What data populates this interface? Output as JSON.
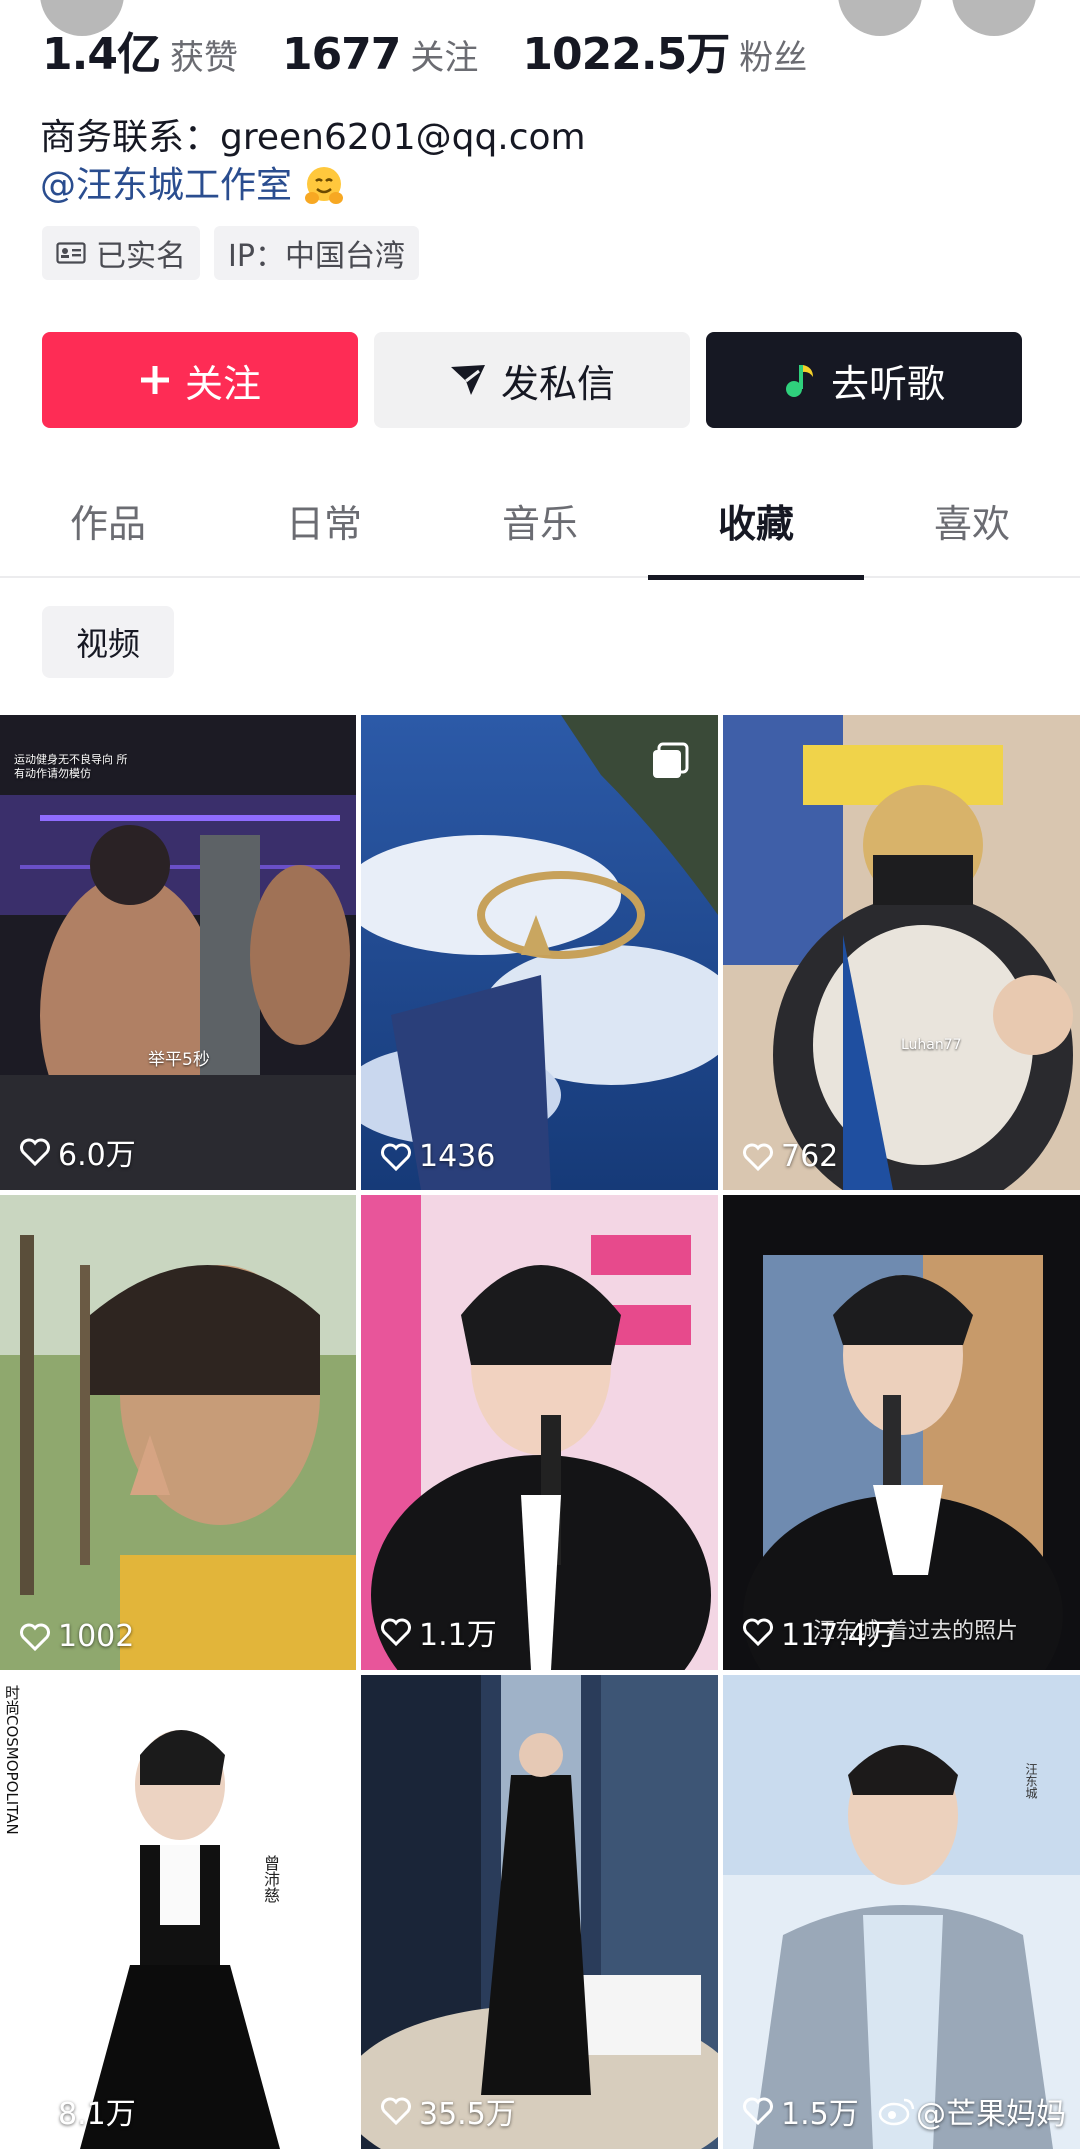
{
  "stats": [
    {
      "num": "1.4亿",
      "label": "获赞"
    },
    {
      "num": "1677",
      "label": "关注"
    },
    {
      "num": "1022.5万",
      "label": "粉丝"
    }
  ],
  "bio": {
    "contact": "商务联系：green6201@qq.com",
    "mention": "@汪东城工作室"
  },
  "tags": [
    "已实名",
    "IP：中国台湾"
  ],
  "actions": {
    "follow": "关注",
    "message": "发私信",
    "music": "去听歌"
  },
  "tabs": [
    "作品",
    "日常",
    "音乐",
    "收藏",
    "喜欢"
  ],
  "active_tab": "收藏",
  "filter": "视频",
  "videos": [
    {
      "likes": "6.0万",
      "overlay": "举平5秒",
      "overlay_small": "运动健身无不良导向 所有动作请勿模仿"
    },
    {
      "likes": "1436"
    },
    {
      "likes": "762",
      "overlay": "Luhan77"
    },
    {
      "likes": "1002"
    },
    {
      "likes": "1.1万"
    },
    {
      "likes": "117.4万",
      "overlay": "汪东城 着过去的照片"
    },
    {
      "likes": "8.1万",
      "overlay": "曾沛慈",
      "overlay_side": "时尚COSMOPOLITAN"
    },
    {
      "likes": "35.5万"
    },
    {
      "likes": "1.5万",
      "overlay": "汪东城"
    }
  ],
  "watermark": "@芒果妈妈",
  "colors": {
    "accent": "#fe2c55",
    "dark": "#161823",
    "link": "#2a4d8f"
  }
}
